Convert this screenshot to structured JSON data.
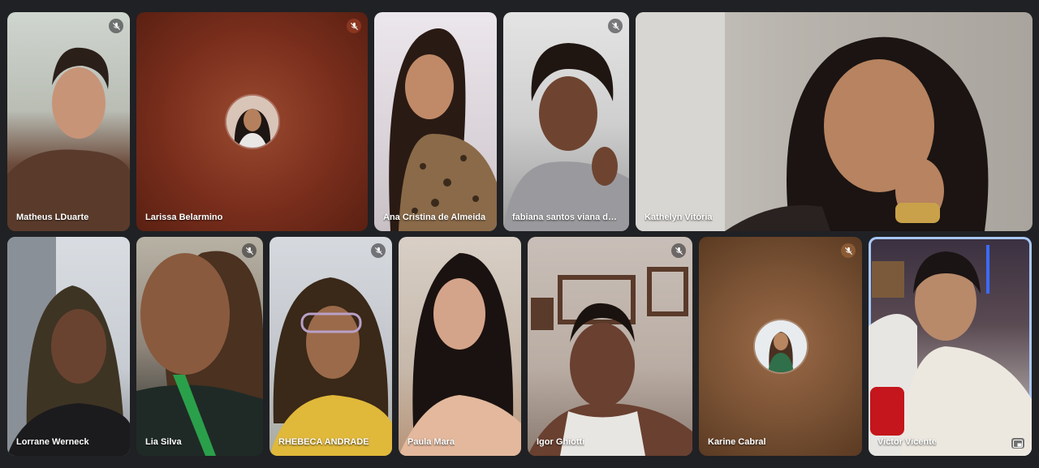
{
  "participants": [
    {
      "name": "Matheus LDuarte",
      "muted": true,
      "video": true
    },
    {
      "name": "Larissa Belarmino",
      "muted": true,
      "video": false
    },
    {
      "name": "Ana Cristina de Almeida",
      "muted": false,
      "video": true
    },
    {
      "name": "fabiana santos viana da ...",
      "muted": true,
      "video": true
    },
    {
      "name": "Kathelyn Vitória",
      "muted": false,
      "video": true
    },
    {
      "name": "Lorrane Werneck",
      "muted": false,
      "video": true
    },
    {
      "name": "Lia Silva",
      "muted": true,
      "video": true
    },
    {
      "name": "RHEBECA ANDRADE",
      "muted": true,
      "video": true
    },
    {
      "name": "Paula Mara",
      "muted": false,
      "video": true
    },
    {
      "name": "Igor Ghiotti",
      "muted": true,
      "video": true
    },
    {
      "name": "Karine Cabral",
      "muted": true,
      "video": false
    },
    {
      "name": "Victor Vicente",
      "muted": false,
      "video": true,
      "active": true
    }
  ],
  "colors": {
    "background": "#202124",
    "active_border": "#a8c7fa",
    "larissa_tile": "#7a2e1c",
    "karine_tile": "#7a5234"
  },
  "icons": [
    "mic-off-icon",
    "picture-in-picture-icon"
  ]
}
